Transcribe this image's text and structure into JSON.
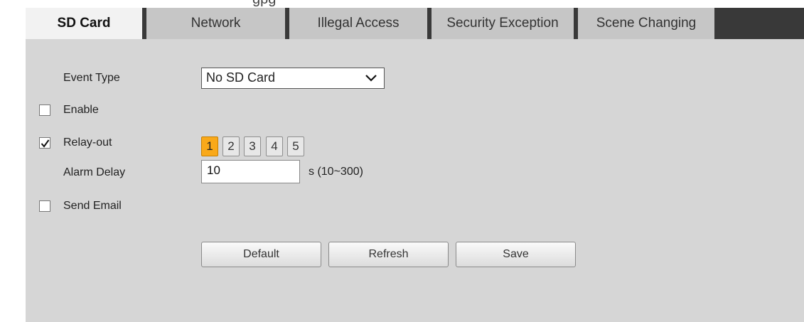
{
  "clipped_header_text": "gpg",
  "tabs": [
    {
      "label": "SD Card",
      "active": true
    },
    {
      "label": "Network",
      "active": false
    },
    {
      "label": "Illegal Access",
      "active": false
    },
    {
      "label": "Security Exception",
      "active": false
    },
    {
      "label": "Scene Changing",
      "active": false
    }
  ],
  "form": {
    "event_type_label": "Event Type",
    "event_type_value": "No SD Card",
    "enable_label": "Enable",
    "enable_checked": false,
    "relay_out_label": "Relay-out",
    "relay_out_checked": true,
    "relay_channels": [
      "1",
      "2",
      "3",
      "4",
      "5"
    ],
    "relay_selected": "1",
    "alarm_delay_label": "Alarm Delay",
    "alarm_delay_value": "10",
    "alarm_delay_unit": "s (10~300)",
    "send_email_label": "Send Email",
    "send_email_checked": false
  },
  "buttons": {
    "default_label": "Default",
    "refresh_label": "Refresh",
    "save_label": "Save"
  },
  "colors": {
    "tabbar_background": "#393939",
    "panel_background": "#d6d6d6",
    "selected_channel": "#f9a91a"
  },
  "icons": {
    "dropdown": "chevron-down-icon",
    "check": "checkmark-icon"
  }
}
